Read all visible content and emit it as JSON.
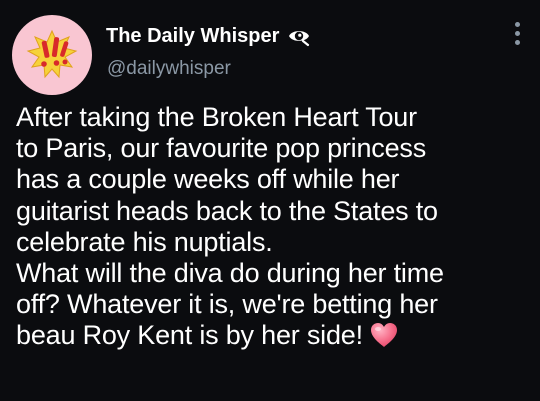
{
  "author": {
    "display_name": "The Daily Whisper",
    "handle": "@dailywhisper",
    "avatar_icon": "exclamation-splash-icon",
    "badge_icon": "eye-icon"
  },
  "menu": {
    "icon": "more-vertical-icon"
  },
  "tweet": {
    "lines": [
      "After taking the Broken Heart Tour",
      "to Paris, our favourite pop princess",
      "has a couple weeks off while her",
      "guitarist heads back to the States to",
      "celebrate his nuptials.",
      "What will the diva do during her time",
      "off? Whatever it is, we're betting her",
      "beau Roy Kent is by her side!"
    ],
    "emoji_icon": "pink-heart-icon"
  },
  "colors": {
    "background": "#0b0c0f",
    "text": "#ffffff",
    "secondary_text": "#8b98a5",
    "avatar_bg": "#f9c6d2",
    "heart": "#f0627f"
  }
}
